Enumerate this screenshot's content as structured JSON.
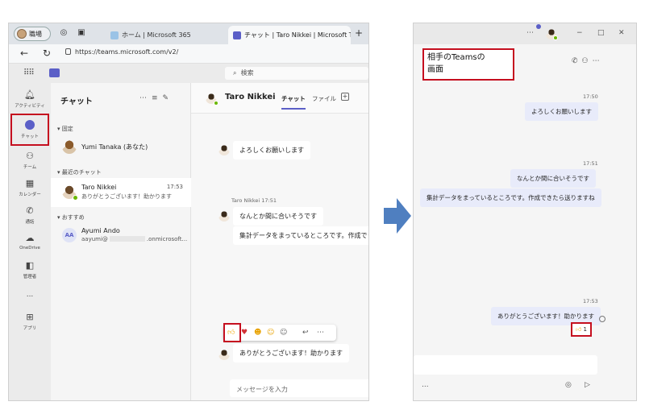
{
  "browser": {
    "profile_label": "職場",
    "tab_inactive": "ホーム | Microsoft 365",
    "tab_active": "チャット | Taro Nikkei | Microsoft T",
    "new_tab": "+",
    "url": "https://teams.microsoft.com/v2/"
  },
  "teams": {
    "search_placeholder": "検索",
    "rail": [
      {
        "label": "アクティビティ",
        "icon": "bell-icon"
      },
      {
        "label": "チャット",
        "icon": "chat-icon"
      },
      {
        "label": "チーム",
        "icon": "teams-icon"
      },
      {
        "label": "カレンダー",
        "icon": "calendar-icon"
      },
      {
        "label": "通話",
        "icon": "phone-icon"
      },
      {
        "label": "OneDrive",
        "icon": "cloud-icon"
      },
      {
        "label": "管理者",
        "icon": "admin-icon"
      },
      {
        "label": "アプリ",
        "icon": "apps-icon"
      }
    ],
    "more": "...",
    "chat_list": {
      "title": "チャット",
      "section_pinned": "固定",
      "section_recent": "最近のチャット",
      "section_suggested": "おすすめ",
      "pinned_name": "Yumi Tanaka (あなた)",
      "recent_name": "Taro Nikkei",
      "recent_time": "17:53",
      "recent_preview": "ありがとうございます！助かります",
      "suggest_initials": "AA",
      "suggest_name": "Ayumi Ando",
      "suggest_email_start": "aayumi@",
      "suggest_email_end": ".onmicrosoft..."
    },
    "conversation": {
      "name": "Taro Nikkei",
      "tab_chat": "チャット",
      "tab_files": "ファイル",
      "msg1": "よろしくお願いします",
      "meta2": "Taro Nikkei  17:51",
      "msg2": "なんとか間に合いそうです",
      "msg3": "集計データをまっているところです。作成できたら送",
      "msg4": "ありがとうございます！助かります",
      "compose_placeholder": "メッセージを入力"
    }
  },
  "right_window": {
    "callout": "相手のTeamsの\n画面",
    "time1": "17:50",
    "msg1": "よろしくお願いします",
    "time2": "17:51",
    "msg2": "なんとか間に合いそうです",
    "msg3": "集計データをまっているところです。作成できたら送りますね",
    "time3": "17:53",
    "msg4": "ありがとうございます！助かります",
    "reaction_count": "1",
    "more": "..."
  },
  "colors": {
    "teams_purple": "#5b5fc7",
    "highlight_red": "#c50f1f",
    "arrow_blue": "#4f7fc0",
    "presence_green": "#6bb700"
  }
}
